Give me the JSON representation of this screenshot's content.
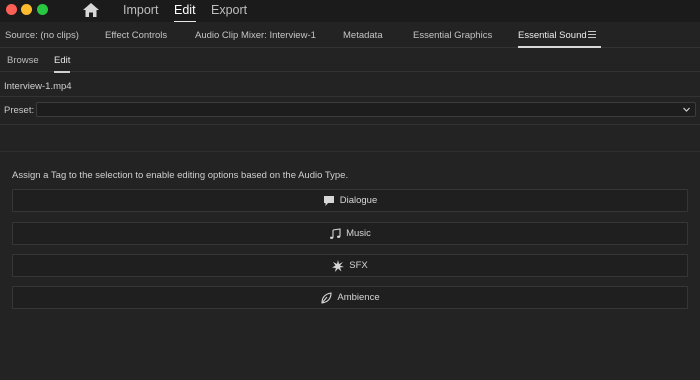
{
  "titlebar": {
    "workspaces": {
      "import": "Import",
      "edit": "Edit",
      "export": "Export"
    }
  },
  "panel_tabs": {
    "source": "Source: (no clips)",
    "effect_controls": "Effect Controls",
    "audio_clip_mixer": "Audio Clip Mixer: Interview-1",
    "metadata": "Metadata",
    "essential_graphics": "Essential Graphics",
    "essential_sound": "Essential Sound"
  },
  "subtabs": {
    "browse": "Browse",
    "edit": "Edit"
  },
  "clip": {
    "name": "Interview-1.mp4"
  },
  "preset": {
    "label": "Preset:",
    "value": ""
  },
  "hint": "Assign a Tag to the selection to enable editing options based on the Audio Type.",
  "tags": {
    "dialogue": "Dialogue",
    "music": "Music",
    "sfx": "SFX",
    "ambience": "Ambience"
  },
  "icons": {
    "home": "home-icon",
    "panel_menu": "hamburger-menu-icon",
    "preset_dropdown": "chevron-down-icon",
    "dialogue": "speech-bubble-icon",
    "music": "music-note-icon",
    "sfx": "burst-icon",
    "ambience": "leaf-icon"
  },
  "colors": {
    "close": "#fe5f57",
    "minimize": "#febc2e",
    "maximize": "#28c840",
    "background": "#232323"
  }
}
